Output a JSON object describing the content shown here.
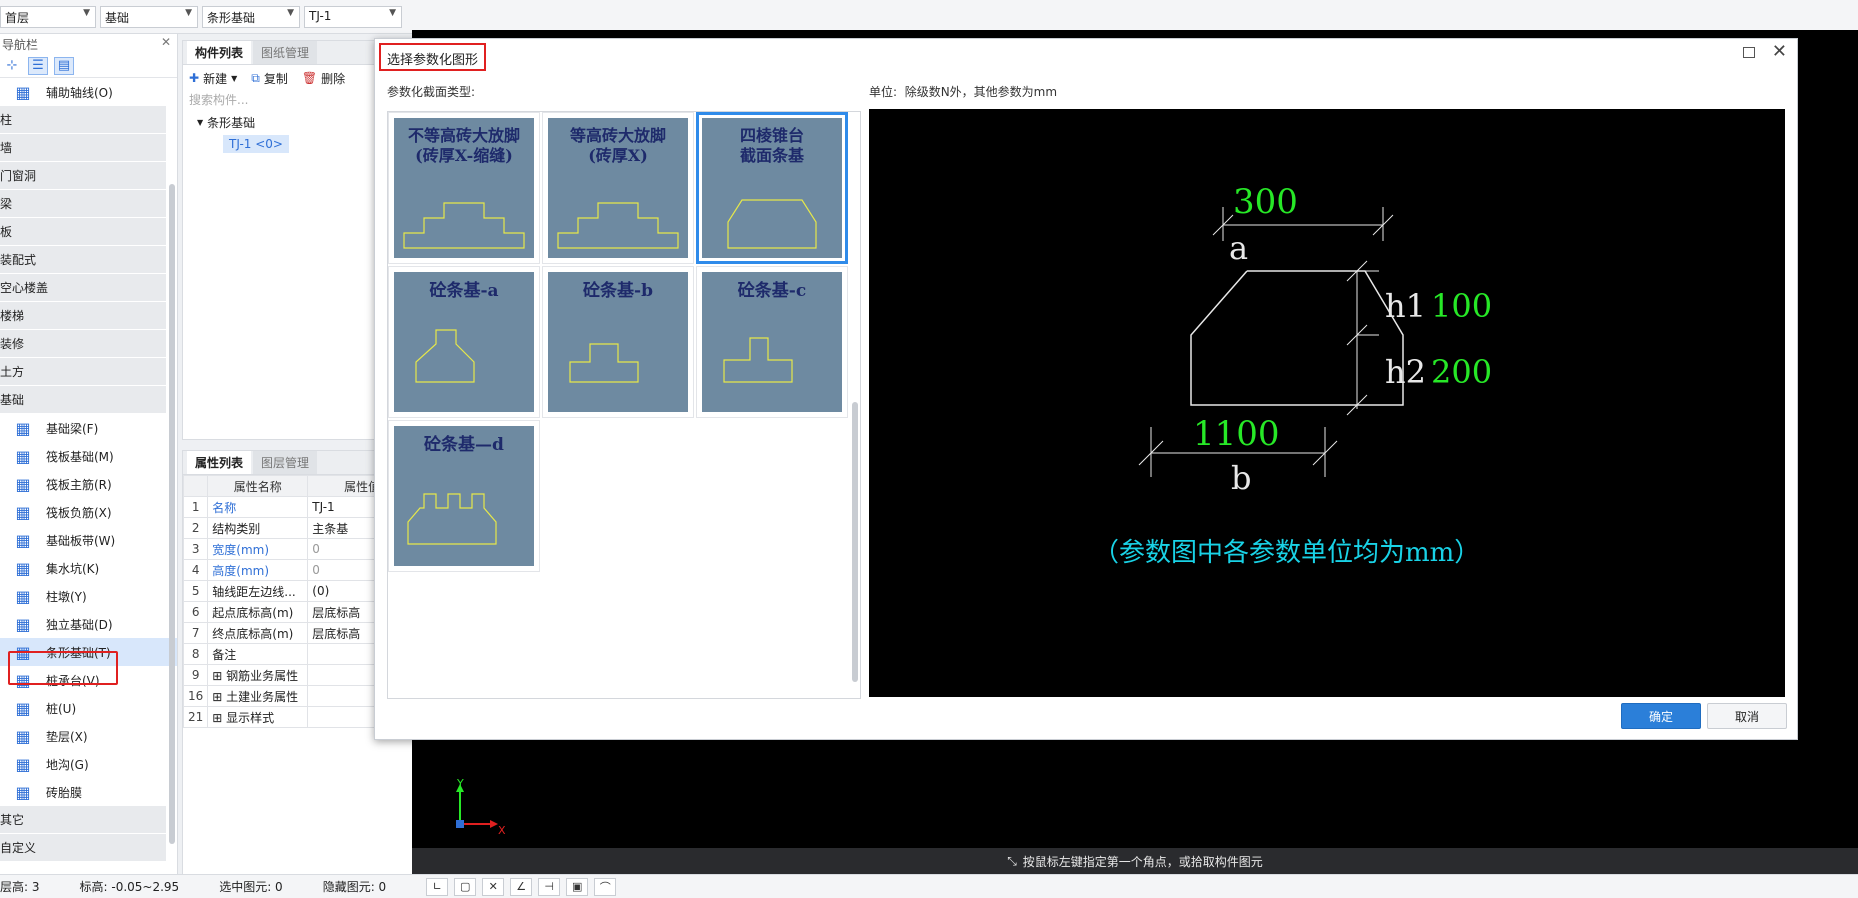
{
  "topbar": {
    "floor": "首层",
    "category": "基础",
    "type": "条形基础",
    "component": "TJ-1"
  },
  "nav": {
    "title": "导航栏",
    "items": [
      {
        "kind": "item",
        "label": "辅助轴线(O)",
        "icon": "grid-icon"
      },
      {
        "kind": "cat",
        "label": "柱"
      },
      {
        "kind": "cat",
        "label": "墙"
      },
      {
        "kind": "cat",
        "label": "门窗洞"
      },
      {
        "kind": "cat",
        "label": "梁"
      },
      {
        "kind": "cat",
        "label": "板"
      },
      {
        "kind": "cat",
        "label": "装配式"
      },
      {
        "kind": "cat",
        "label": "空心楼盖"
      },
      {
        "kind": "cat",
        "label": "楼梯"
      },
      {
        "kind": "cat",
        "label": "装修"
      },
      {
        "kind": "cat",
        "label": "土方"
      },
      {
        "kind": "cat",
        "label": "基础"
      },
      {
        "kind": "item",
        "label": "基础梁(F)",
        "icon": "beam-icon"
      },
      {
        "kind": "item",
        "label": "筏板基础(M)",
        "icon": "raft-icon"
      },
      {
        "kind": "item",
        "label": "筏板主筋(R)",
        "icon": "rebar-icon"
      },
      {
        "kind": "item",
        "label": "筏板负筋(X)",
        "icon": "neg-rebar-icon"
      },
      {
        "kind": "item",
        "label": "基础板带(W)",
        "icon": "strip-icon"
      },
      {
        "kind": "item",
        "label": "集水坑(K)",
        "icon": "sump-icon"
      },
      {
        "kind": "item",
        "label": "柱墩(Y)",
        "icon": "pier-icon"
      },
      {
        "kind": "item",
        "label": "独立基础(D)",
        "icon": "isolated-footing-icon"
      },
      {
        "kind": "item",
        "label": "条形基础(T)",
        "icon": "strip-footing-icon",
        "selected": true
      },
      {
        "kind": "item",
        "label": "桩承台(V)",
        "icon": "pile-cap-icon"
      },
      {
        "kind": "item",
        "label": "桩(U)",
        "icon": "pile-icon"
      },
      {
        "kind": "item",
        "label": "垫层(X)",
        "icon": "cushion-icon"
      },
      {
        "kind": "item",
        "label": "地沟(G)",
        "icon": "trench-icon"
      },
      {
        "kind": "item",
        "label": "砖胎膜",
        "icon": "brick-mold-icon"
      },
      {
        "kind": "cat",
        "label": "其它"
      },
      {
        "kind": "cat",
        "label": "自定义"
      }
    ]
  },
  "clist": {
    "tab1": "构件列表",
    "tab2": "图纸管理",
    "new": "新建",
    "copy": "复制",
    "delete": "删除",
    "search_placeholder": "搜索构件...",
    "tree_parent": "条形基础",
    "tree_child": "TJ-1 <0>"
  },
  "props": {
    "tab1": "属性列表",
    "tab2": "图层管理",
    "col_name": "属性名称",
    "col_value": "属性值",
    "rows": [
      {
        "n": "1",
        "k": "名称",
        "v": "TJ-1",
        "blue": true,
        "grayv": false
      },
      {
        "n": "2",
        "k": "结构类别",
        "v": "主条基",
        "blue": false,
        "grayv": false
      },
      {
        "n": "3",
        "k": "宽度(mm)",
        "v": "0",
        "blue": true,
        "grayv": true
      },
      {
        "n": "4",
        "k": "高度(mm)",
        "v": "0",
        "blue": true,
        "grayv": true
      },
      {
        "n": "5",
        "k": "轴线距左边线...",
        "v": "(0)",
        "blue": false,
        "grayv": false
      },
      {
        "n": "6",
        "k": "起点底标高(m)",
        "v": "层底标高",
        "blue": false,
        "grayv": false
      },
      {
        "n": "7",
        "k": "终点底标高(m)",
        "v": "层底标高",
        "blue": false,
        "grayv": false
      },
      {
        "n": "8",
        "k": "备注",
        "v": "",
        "blue": false,
        "grayv": false
      },
      {
        "n": "9",
        "k": "钢筋业务属性",
        "v": "",
        "blue": false,
        "grayv": false,
        "expand": true
      },
      {
        "n": "16",
        "k": "土建业务属性",
        "v": "",
        "blue": false,
        "grayv": false,
        "expand": true
      },
      {
        "n": "21",
        "k": "显示样式",
        "v": "",
        "blue": false,
        "grayv": false,
        "expand": true
      }
    ]
  },
  "dialog": {
    "title": "选择参数化图形",
    "section_type": "参数化截面类型:",
    "unit_label": "单位:",
    "unit_text": "除级数N外，其他参数为mm",
    "ok": "确定",
    "cancel": "取消",
    "shapes": [
      {
        "title1": "不等高砖大放脚",
        "title2": "(砖厚X-缩缝)"
      },
      {
        "title1": "等高砖大放脚",
        "title2": "(砖厚X)"
      },
      {
        "title1": "四棱锥台",
        "title2": "截面条基",
        "selected": true
      },
      {
        "title1": "砼条基-a"
      },
      {
        "title1": "砼条基-b"
      },
      {
        "title1": "砼条基-c"
      },
      {
        "title1": "砼条基—d"
      }
    ],
    "preview": {
      "a_value": "300",
      "a_label": "a",
      "h1_label": "h1",
      "h1_value": "100",
      "h2_label": "h2",
      "h2_value": "200",
      "b_value": "1100",
      "b_label": "b",
      "note": "（参数图中各参数单位均为mm）"
    }
  },
  "canvas": {
    "hint": "按鼠标左键指定第一个角点，或拾取构件图元",
    "axis_x": "X",
    "axis_y": "Y"
  },
  "status": {
    "floor_height": "层高:  3",
    "elevation": "标高:  -0.05~2.95",
    "selected": "选中图元:  0",
    "hidden": "隐藏图元:  0"
  },
  "colors": {
    "accent": "#2b7fd9",
    "highlight_red": "#e02020",
    "cad_green": "#27e827",
    "cad_cyan": "#19d2e6"
  }
}
